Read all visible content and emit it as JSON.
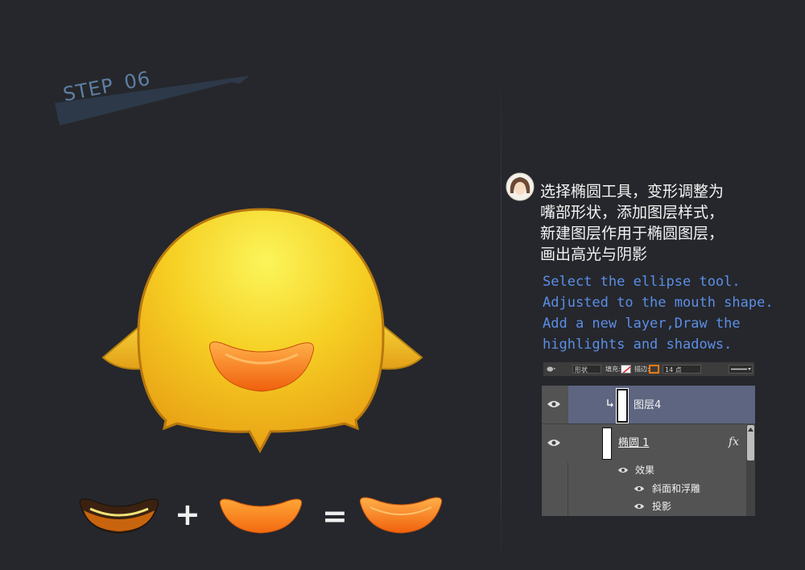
{
  "step": {
    "label": "STEP",
    "number": "06"
  },
  "operators": {
    "plus": "+",
    "equals": "="
  },
  "tip": {
    "chinese_lines": [
      "选择椭圆工具，变形调整为",
      "嘴部形状，添加图层样式，",
      "新建图层作用于椭圆图层，",
      "画出高光与阴影"
    ],
    "english_lines": [
      "Select the ellipse tool.",
      "Adjusted to the mouth shape.",
      "Add a new layer,Draw the",
      "highlights and shadows."
    ]
  },
  "options_bar": {
    "mode": "形状",
    "fill_label": "填充:",
    "stroke_label": "描边:",
    "stroke_size": "14 点",
    "stroke_color": "#f07a12"
  },
  "layers": {
    "items": [
      {
        "name": "图层4",
        "selected": true,
        "clipped": true
      },
      {
        "name": "椭圆 1",
        "selected": false,
        "fx": "fx"
      }
    ],
    "effects_label": "效果",
    "effects": [
      "斜面和浮雕",
      "投影"
    ]
  },
  "colors": {
    "background": "#25272c",
    "body_yellow": "#f6cf1e",
    "mouth_orange": "#f07a12",
    "english_text": "#5c8ee6",
    "selected_layer": "#5d6580"
  }
}
